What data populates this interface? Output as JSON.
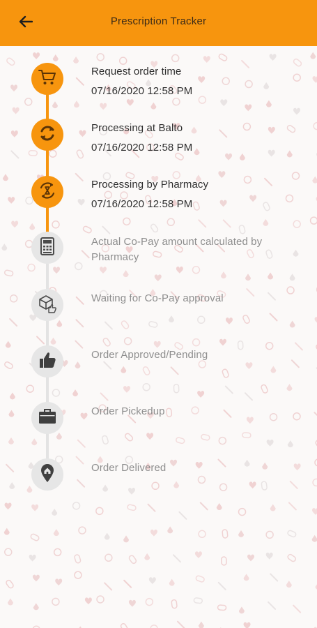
{
  "header": {
    "title": "Prescription Tracker",
    "back_icon": "arrow-left-icon"
  },
  "colors": {
    "accent": "#f7950e",
    "inactive_circle": "#e6e6e6",
    "inactive_line": "#e3e3e3",
    "active_icon": "#5a3306",
    "inactive_icon": "#4a4a4a",
    "text": "#2e2e2e",
    "inactive_text": "#8e8e8e"
  },
  "steps": [
    {
      "title": "Request order time",
      "time": "07/16/2020 12:58 PM",
      "status": "completed",
      "icon": "shopping-cart-icon"
    },
    {
      "title": "Processing at Balto",
      "time": "07/16/2020 12:58 PM",
      "status": "completed",
      "icon": "sync-icon"
    },
    {
      "title": "Processing by Pharmacy",
      "time": "07/16/2020 12:58 PM",
      "status": "completed",
      "icon": "hourglass-sync-icon"
    },
    {
      "title": "Actual Co-Pay amount calculated by Pharmacy",
      "time": "",
      "status": "pending",
      "icon": "calculator-icon"
    },
    {
      "title": "Waiting for Co-Pay approval",
      "time": "",
      "status": "pending",
      "icon": "box-thumbs-up-icon"
    },
    {
      "title": "Order Approved/Pending",
      "time": "",
      "status": "pending",
      "icon": "thumbs-up-icon"
    },
    {
      "title": "Order Pickedup",
      "time": "",
      "status": "pending",
      "icon": "briefcase-icon"
    },
    {
      "title": "Order Delivered",
      "time": "",
      "status": "pending",
      "icon": "home-pin-icon"
    }
  ]
}
